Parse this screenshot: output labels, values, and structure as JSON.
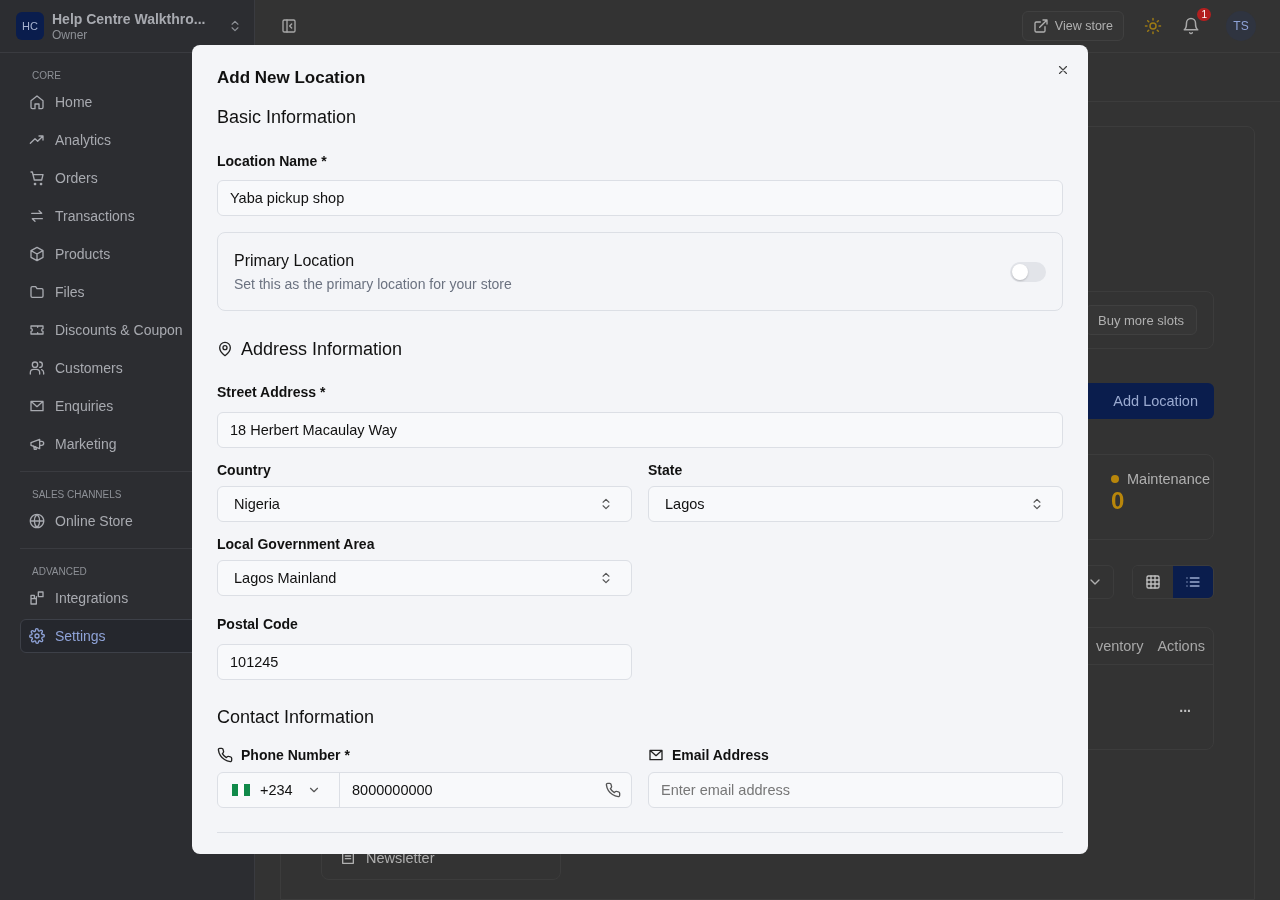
{
  "sidebar": {
    "workspace": {
      "initials": "HC",
      "name": "Help Centre Walkthro...",
      "role": "Owner"
    },
    "sections": [
      {
        "heading": "CORE",
        "items": [
          {
            "label": "Home",
            "selected": false
          },
          {
            "label": "Analytics",
            "selected": false
          },
          {
            "label": "Orders",
            "selected": false
          },
          {
            "label": "Transactions",
            "selected": false
          },
          {
            "label": "Products",
            "selected": false
          },
          {
            "label": "Files",
            "selected": false
          },
          {
            "label": "Discounts & Coupon",
            "selected": false
          },
          {
            "label": "Customers",
            "selected": false
          },
          {
            "label": "Enquiries",
            "selected": false
          },
          {
            "label": "Marketing",
            "selected": false
          }
        ]
      },
      {
        "heading": "SALES CHANNELS",
        "items": [
          {
            "label": "Online Store",
            "selected": false
          }
        ]
      },
      {
        "heading": "ADVANCED",
        "items": [
          {
            "label": "Integrations",
            "selected": false
          },
          {
            "label": "Settings",
            "selected": true
          }
        ]
      }
    ]
  },
  "topbar": {
    "view_store": "View store",
    "notification_count": "1",
    "avatar": "TS"
  },
  "page": {
    "buy_slots": "Buy more slots",
    "add_location": "Add Location",
    "stat": {
      "label": "Maintenance",
      "value": "0",
      "color": "#b8860b"
    },
    "views": [
      {
        "kind": "grid",
        "selected": false
      },
      {
        "kind": "list",
        "selected": true
      }
    ],
    "table": {
      "columns": [
        "ventory",
        "Actions"
      ],
      "row_action": "..."
    },
    "channel": "Newsletter"
  },
  "modal": {
    "title": "Add New Location",
    "basic": {
      "heading": "Basic Information",
      "name_label": "Location Name *",
      "name_value": "Yaba pickup shop",
      "primary": {
        "title": "Primary Location",
        "description": "Set this as the primary location for your store",
        "on": false
      }
    },
    "address": {
      "heading": "Address Information",
      "street_label": "Street Address *",
      "street_value": "18 Herbert Macaulay Way",
      "country_label": "Country",
      "country": "Nigeria",
      "state_label": "State",
      "state": "Lagos",
      "lga_label": "Local Government Area",
      "lga": "Lagos Mainland",
      "postal_label": "Postal Code",
      "postal": "101245"
    },
    "contact": {
      "heading": "Contact Information",
      "phone_label": "Phone Number *",
      "dial_code": "+234",
      "phone": "8000000000",
      "email_label": "Email Address",
      "email_placeholder": "Enter email address"
    }
  }
}
